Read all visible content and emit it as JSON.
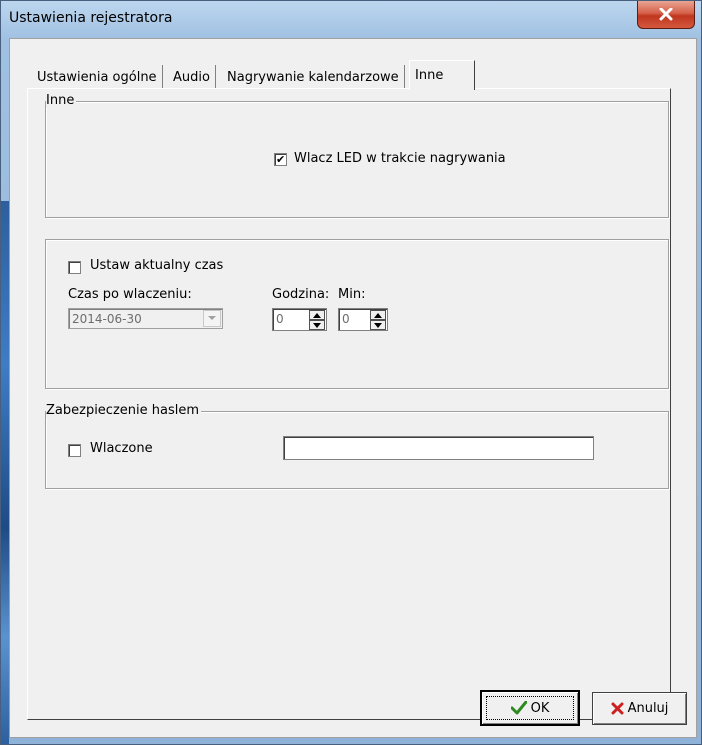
{
  "window": {
    "title": "Ustawienia rejestratora",
    "close_icon": "close-icon",
    "close_color": "#c7402a"
  },
  "tabs": [
    {
      "label": "Ustawienia ogólne",
      "active": false
    },
    {
      "label": "Audio",
      "active": false
    },
    {
      "label": "Nagrywanie kalendarzowe",
      "active": false
    },
    {
      "label": "Inne",
      "active": true
    }
  ],
  "group_inne": {
    "title": "Inne",
    "led_checkbox": {
      "label": "Wlacz LED w trakcie nagrywania",
      "checked": true
    }
  },
  "group_time": {
    "set_time_checkbox": {
      "label": "Ustaw aktualny czas",
      "checked": false
    },
    "time_after_label": "Czas po wlaczeniu:",
    "date_value": "2014-06-30",
    "hour_label": "Godzina:",
    "hour_value": "0",
    "min_label": "Min:",
    "min_value": "0"
  },
  "group_password": {
    "title": "Zabezpieczenie haslem",
    "enabled_checkbox": {
      "label": "Wlaczone",
      "checked": false
    },
    "password_value": ""
  },
  "buttons": {
    "ok_label": "OK",
    "ok_icon": "checkmark-icon",
    "ok_icon_color": "#2c8a1e",
    "cancel_label": "Anuluj",
    "cancel_icon": "x-icon",
    "cancel_icon_color": "#cc1f1f"
  }
}
